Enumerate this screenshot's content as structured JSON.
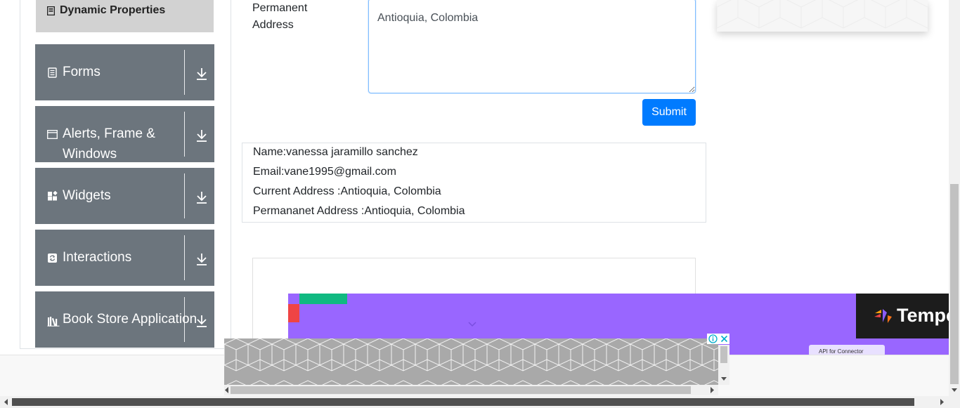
{
  "sidebar": {
    "dynamic_properties": "Dynamic Properties",
    "groups": [
      {
        "label": "Forms",
        "icon": "form-icon"
      },
      {
        "label": "Alerts, Frame & Windows",
        "icon": "window-icon"
      },
      {
        "label": "Widgets",
        "icon": "widgets-icon"
      },
      {
        "label": "Interactions",
        "icon": "interactions-icon"
      },
      {
        "label": "Book Store Application",
        "icon": "books-icon"
      }
    ]
  },
  "form": {
    "permanent_address_label": "Permanent Address",
    "permanent_address_value": "Antioquia, Colombia",
    "submit_label": "Submit"
  },
  "output": {
    "name": "Name:vanessa jaramillo sanchez",
    "email": "Email:vane1995@gmail.com",
    "current_address": "Current Address :Antioquia, Colombia",
    "permanent_address": "Permananet Address :Antioquia, Colombia"
  },
  "ad": {
    "brand": "Tempo",
    "chip_text": "API for Connector"
  },
  "colors": {
    "sidebar_group": "#6c757d",
    "primary": "#007bff",
    "banner": "#9966ff"
  }
}
